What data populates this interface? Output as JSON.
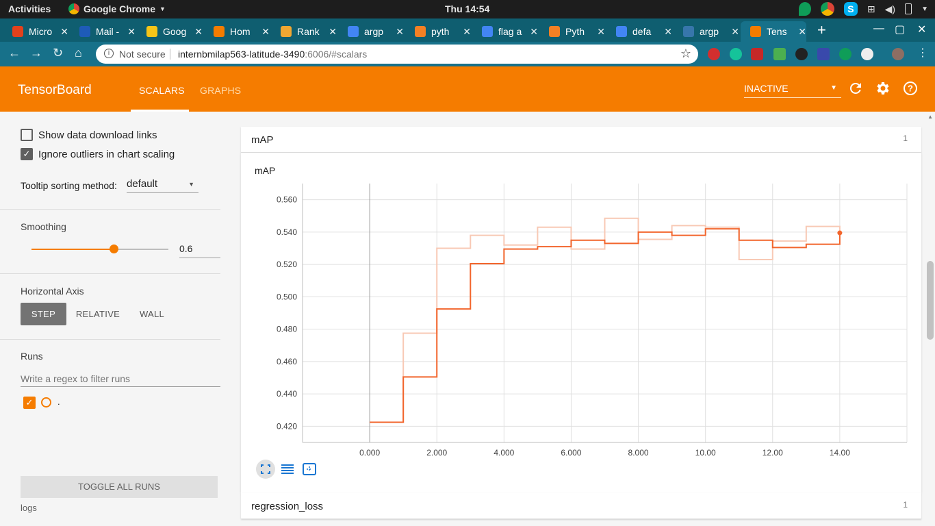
{
  "topbar": {
    "activities": "Activities",
    "app_name": "Google Chrome",
    "clock": "Thu 14:54"
  },
  "tabs": [
    {
      "title": "Micro",
      "color": "#e3411c"
    },
    {
      "title": "Mail -",
      "color": "#1e5bb8"
    },
    {
      "title": "Goog",
      "color": "#f6c518"
    },
    {
      "title": "Hom",
      "color": "#f57c00"
    },
    {
      "title": "Rank",
      "color": "#f0a732"
    },
    {
      "title": "argp",
      "color": "#4285f4"
    },
    {
      "title": "pyth",
      "color": "#f48024"
    },
    {
      "title": "flag a",
      "color": "#4285f4"
    },
    {
      "title": "Pyth",
      "color": "#f48024"
    },
    {
      "title": "defa",
      "color": "#4285f4"
    },
    {
      "title": "argp",
      "color": "#3776ab"
    },
    {
      "title": "Tens",
      "color": "#f57c00"
    }
  ],
  "address": {
    "security": "Not secure",
    "host": "internbmilap563-latitude-3490",
    "path": ":6006/#scalars"
  },
  "tensorboard": {
    "brand": "TensorBoard",
    "nav": [
      "SCALARS",
      "GRAPHS"
    ],
    "status": "INACTIVE"
  },
  "sidebar": {
    "show_download": "Show data download links",
    "ignore_outliers": "Ignore outliers in chart scaling",
    "tooltip_label": "Tooltip sorting method:",
    "tooltip_value": "default",
    "smoothing_label": "Smoothing",
    "smoothing_value": "0.6",
    "smoothing_fraction": 0.6,
    "axis_label": "Horizontal Axis",
    "axis_options": [
      "STEP",
      "RELATIVE",
      "WALL"
    ],
    "runs_label": "Runs",
    "runs_filter_placeholder": "Write a regex to filter runs",
    "run_name": ".",
    "toggle_runs": "TOGGLE ALL RUNS",
    "logs": "logs"
  },
  "main": {
    "group1_name": "mAP",
    "group1_count": "1",
    "card_title": "mAP",
    "group2_name": "regression_loss",
    "group2_count": "1"
  },
  "chart_data": {
    "type": "line",
    "title": "mAP",
    "xlabel": "",
    "ylabel": "",
    "xlim": [
      -2,
      16
    ],
    "ylim": [
      0.41,
      0.57
    ],
    "xticks": [
      "0.000",
      "2.000",
      "4.000",
      "6.000",
      "8.000",
      "10.00",
      "12.00",
      "14.00"
    ],
    "yticks": [
      "0.420",
      "0.440",
      "0.460",
      "0.480",
      "0.500",
      "0.520",
      "0.540",
      "0.560"
    ],
    "grid": true,
    "series": [
      {
        "kind": "raw",
        "color": "#f8c9b5",
        "x": [
          0,
          1,
          2,
          3,
          4,
          5,
          6,
          7,
          8,
          9,
          10,
          11,
          12,
          13,
          14
        ],
        "y": [
          0.4225,
          0.4775,
          0.53,
          0.538,
          0.532,
          0.543,
          0.5295,
          0.5485,
          0.5355,
          0.544,
          0.543,
          0.523,
          0.5345,
          0.5435,
          0.5395
        ]
      },
      {
        "kind": "smoothed",
        "color": "#f2652c",
        "x": [
          0,
          1,
          2,
          3,
          4,
          5,
          6,
          7,
          8,
          9,
          10,
          11,
          12,
          13,
          14
        ],
        "y": [
          0.4225,
          0.4505,
          0.4925,
          0.5205,
          0.5295,
          0.531,
          0.535,
          0.533,
          0.54,
          0.538,
          0.542,
          0.535,
          0.5305,
          0.5325,
          0.5395
        ]
      }
    ]
  }
}
